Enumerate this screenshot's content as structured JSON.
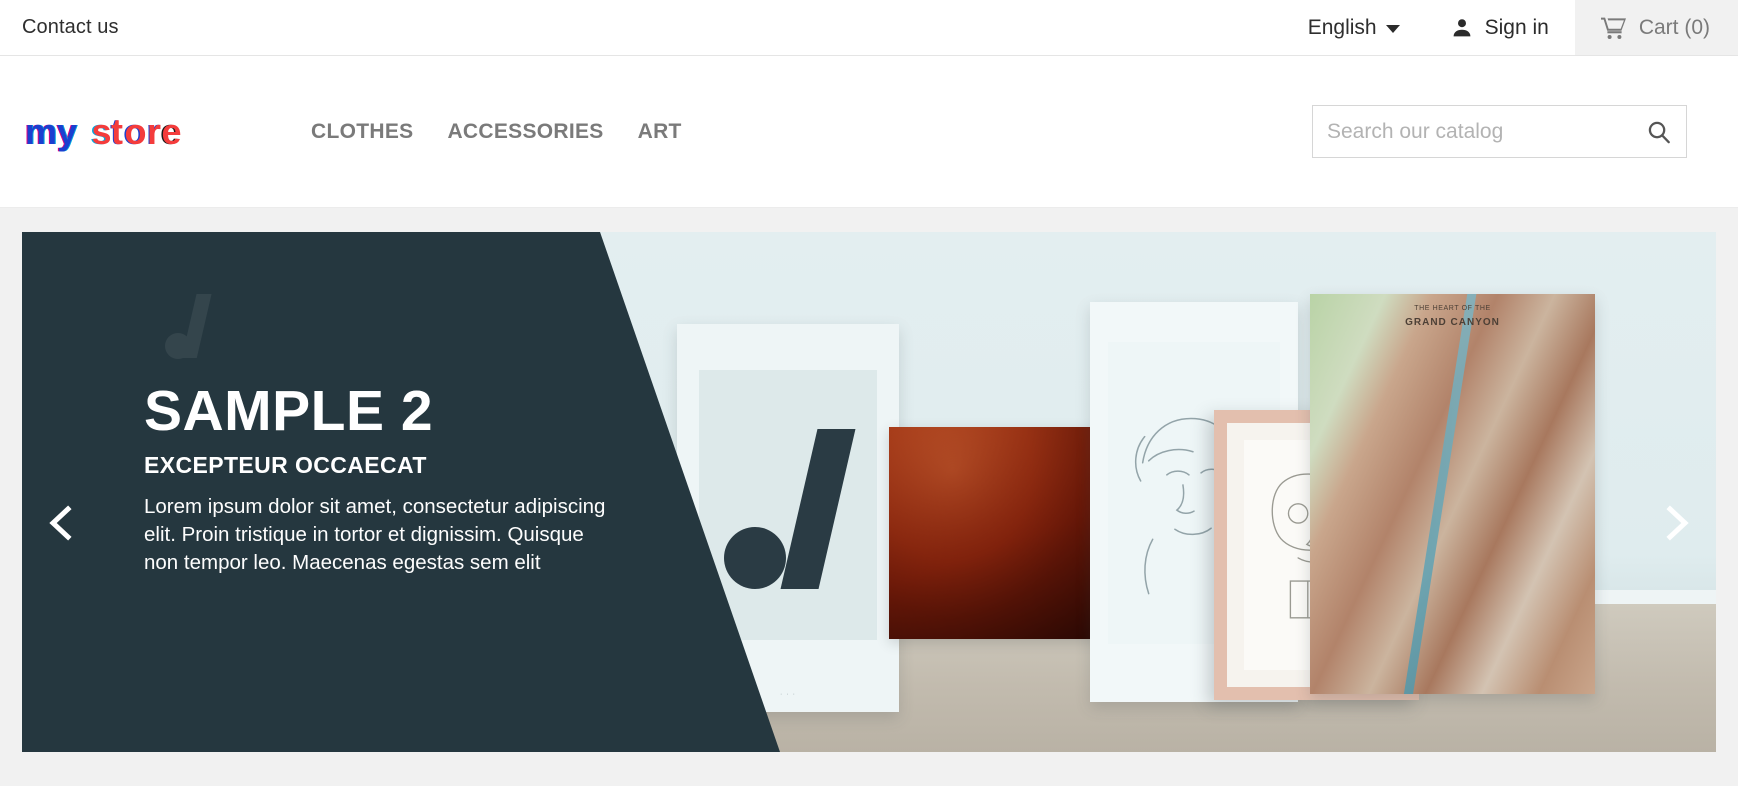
{
  "topbar": {
    "contact_label": "Contact us",
    "language": "English",
    "signin_label": "Sign in",
    "cart_label": "Cart (0)",
    "cart_count": 0,
    "cart_bg": "#f1f1f1"
  },
  "header": {
    "logo_text": "my store",
    "logo_colors": {
      "blue": "#1b3fd0",
      "magenta": "#e6007e",
      "red": "#f43c3c",
      "cyan": "#00a9e0",
      "dark": "#1a1a1a"
    },
    "menu": [
      {
        "label": "CLOTHES"
      },
      {
        "label": "ACCESSORIES"
      },
      {
        "label": "ART"
      }
    ],
    "search": {
      "placeholder": "Search our catalog",
      "value": "",
      "icon": "search-icon"
    }
  },
  "slider": {
    "background": "#f1f1f1",
    "panel_color": "#25373f",
    "prev_icon": "chevron-left-icon",
    "next_icon": "chevron-right-icon",
    "slide": {
      "title": "SAMPLE 2",
      "subtitle": "EXCEPTEUR OCCAECAT",
      "description": "Lorem ipsum dolor sit amet, consectetur adipiscing elit. Proin tristique in tortor et dignissim. Quisque non tempor leo. Maecenas egestas sem elit"
    },
    "artwork": {
      "map_poster_title": "THE HEART OF THE",
      "map_poster_subtitle": "GRAND CANYON"
    }
  }
}
